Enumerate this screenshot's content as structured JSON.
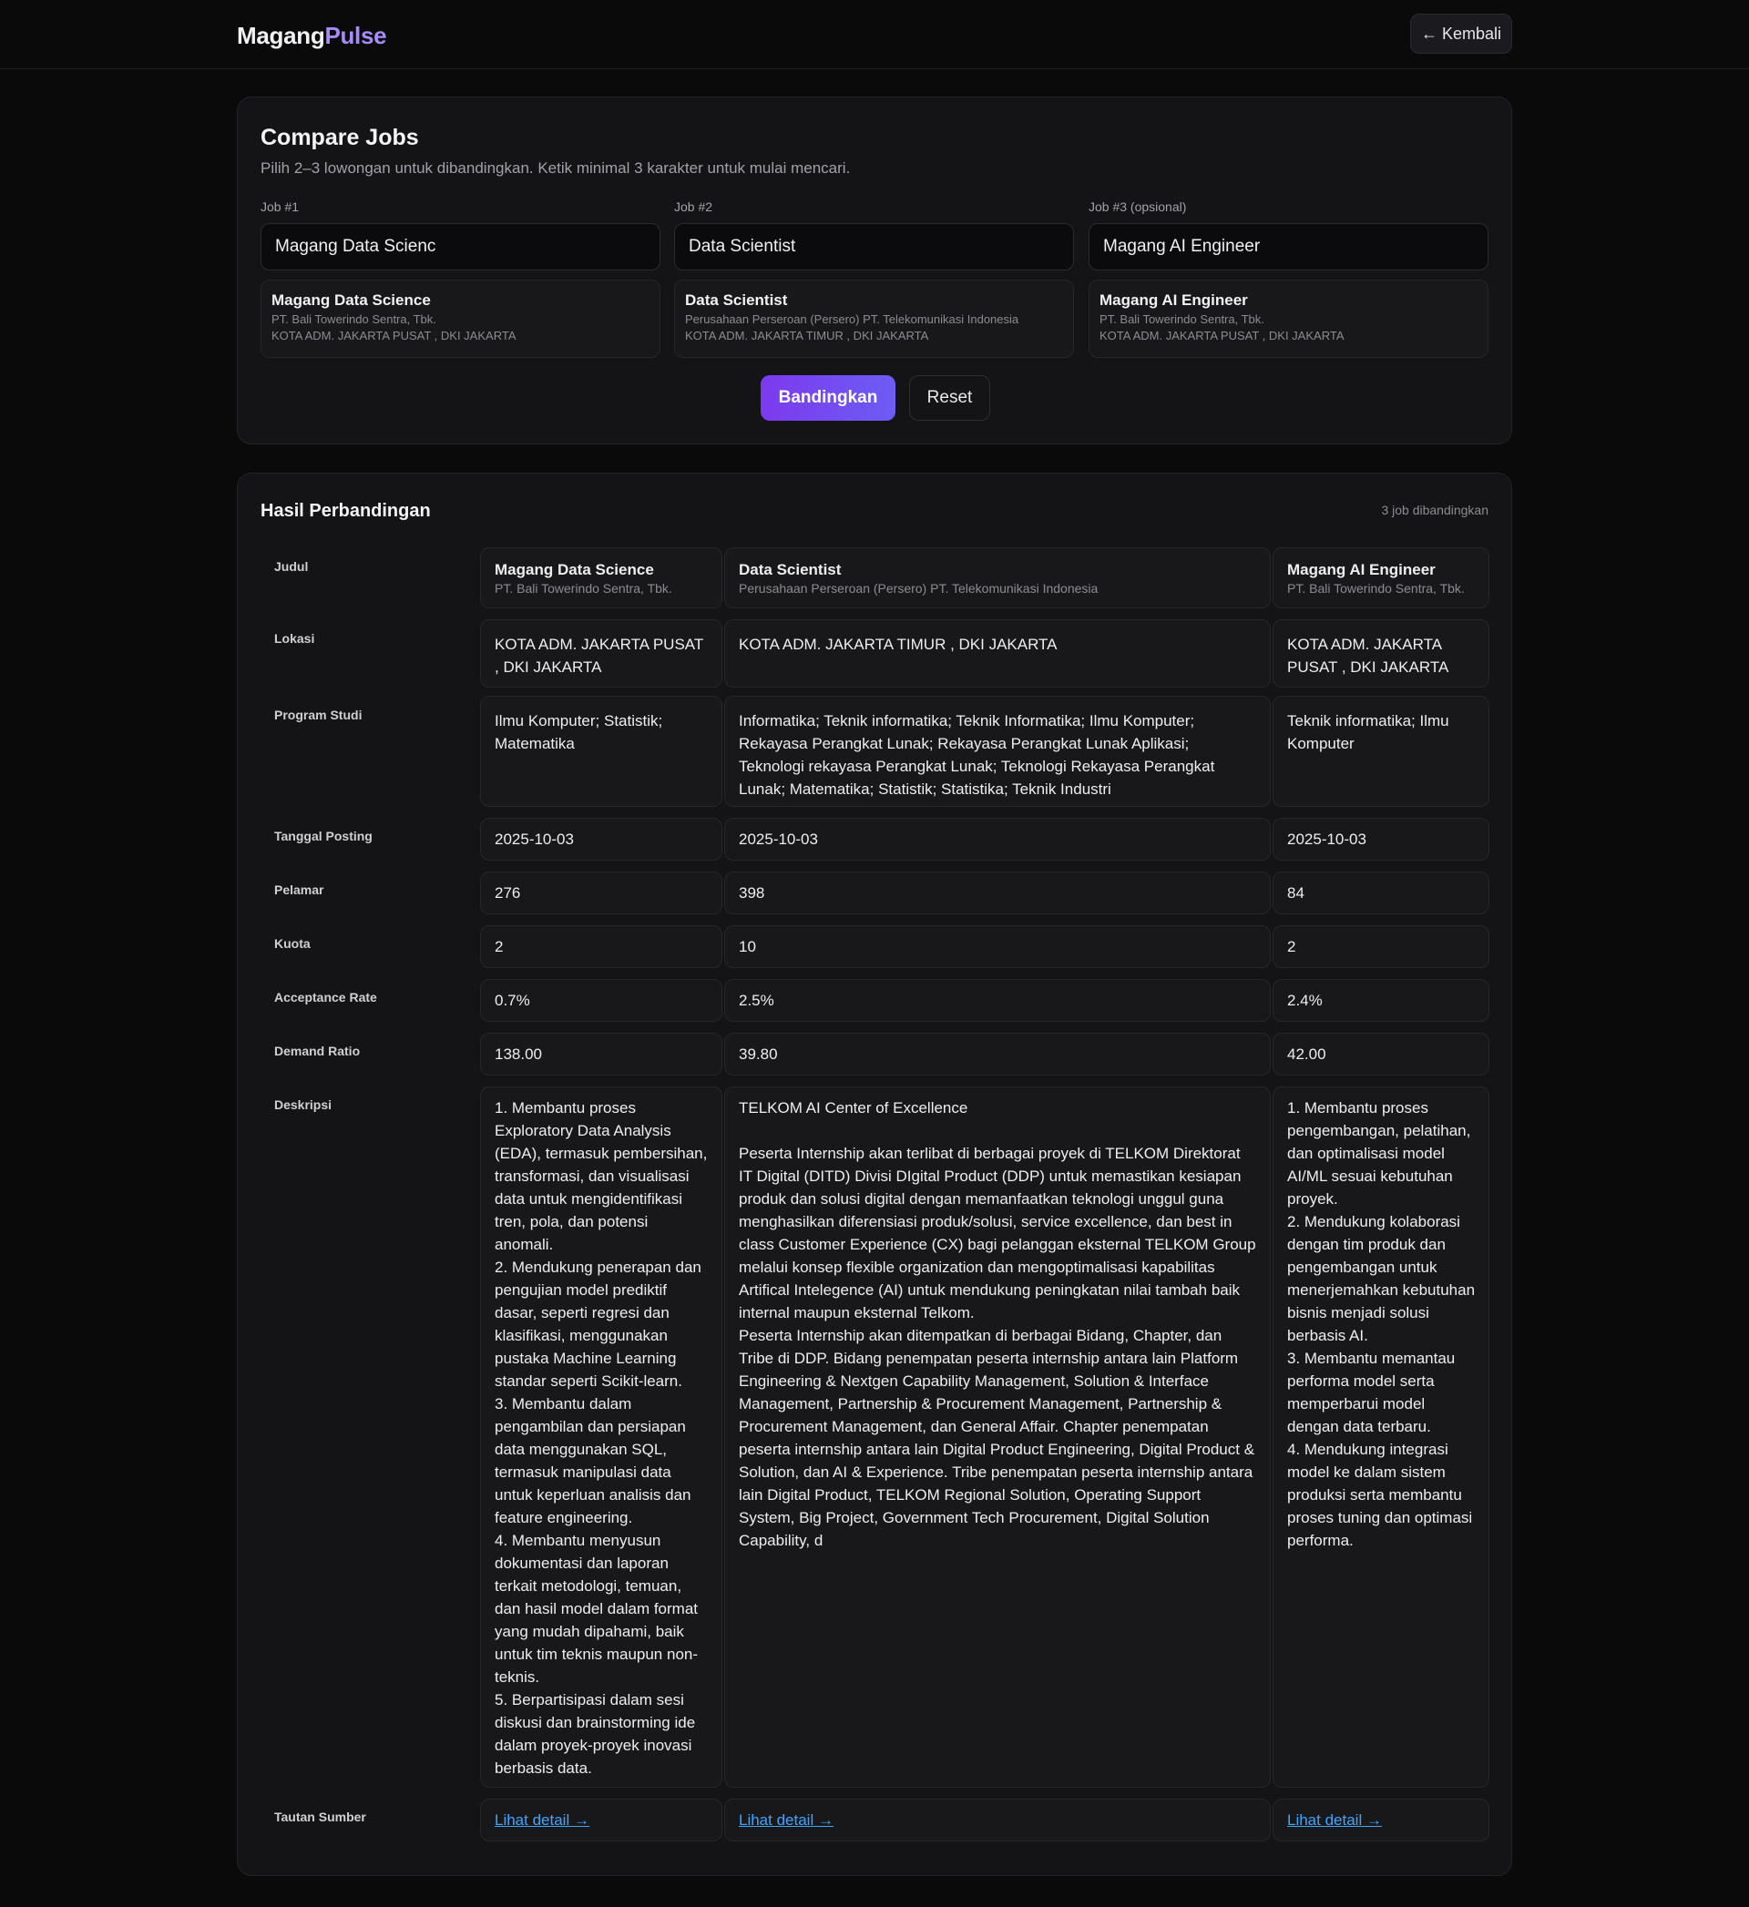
{
  "brand": {
    "part1": "Magang",
    "part2": "Pulse",
    "accent_color": "#a78bfa"
  },
  "header": {
    "back_label": "← Kembali"
  },
  "compare": {
    "title": "Compare Jobs",
    "subtitle": "Pilih 2–3 lowongan untuk dibandingkan. Ketik minimal 3 karakter untuk mulai mencari.",
    "slots": [
      {
        "label": "Job #1",
        "value": "Magang Data Scienc",
        "selected": {
          "title": "Magang Data Science",
          "company": "PT. Bali Towerindo Sentra, Tbk.",
          "location": "KOTA ADM. JAKARTA PUSAT , DKI JAKARTA"
        }
      },
      {
        "label": "Job #2",
        "value": "Data Scientist",
        "selected": {
          "title": "Data Scientist",
          "company": "Perusahaan Perseroan (Persero) PT. Telekomunikasi Indonesia",
          "location": "KOTA ADM. JAKARTA TIMUR , DKI JAKARTA"
        }
      },
      {
        "label": "Job #3 (opsional)",
        "value": "Magang AI Engineer",
        "selected": {
          "title": "Magang AI Engineer",
          "company": "PT. Bali Towerindo Sentra, Tbk.",
          "location": "KOTA ADM. JAKARTA PUSAT , DKI JAKARTA"
        }
      }
    ],
    "compare_button": "Bandingkan",
    "reset_button": "Reset",
    "primary_color": "#7c3aed"
  },
  "results": {
    "title": "Hasil Perbandingan",
    "count_text": "3 job dibandingkan",
    "row_labels": {
      "title": "Judul",
      "location": "Lokasi",
      "program": "Program Studi",
      "posted": "Tanggal Posting",
      "applicants": "Pelamar",
      "quota": "Kuota",
      "acceptance": "Acceptance Rate",
      "demand": "Demand Ratio",
      "description": "Deskripsi",
      "source": "Tautan Sumber"
    },
    "jobs": [
      {
        "title": "Magang Data Science",
        "company": "PT. Bali Towerindo Sentra, Tbk.",
        "location": "KOTA ADM. JAKARTA PUSAT , DKI JAKARTA",
        "program": "Ilmu Komputer; Statistik; Matematika",
        "posted": "2025-10-03",
        "applicants": "276",
        "quota": "2",
        "acceptance": "0.7%",
        "demand": "138.00",
        "description": "1. Membantu proses Exploratory Data Analysis (EDA), termasuk pembersihan, transformasi, dan visualisasi data untuk mengidentifikasi tren, pola, dan potensi anomali.\n2. Mendukung penerapan dan pengujian model prediktif dasar, seperti regresi dan klasifikasi, menggunakan pustaka Machine Learning standar seperti Scikit-learn.\n3. Membantu dalam pengambilan dan persiapan data menggunakan SQL, termasuk manipulasi data untuk keperluan analisis dan feature engineering.\n4. Membantu menyusun dokumentasi dan laporan terkait metodologi, temuan, dan hasil model dalam format yang mudah dipahami, baik untuk tim teknis maupun non-teknis.\n5. Berpartisipasi dalam sesi diskusi dan brainstorming ide dalam proyek-proyek inovasi berbasis data.",
        "link": "Lihat detail →"
      },
      {
        "title": "Data Scientist",
        "company": "Perusahaan Perseroan (Persero) PT. Telekomunikasi Indonesia",
        "location": "KOTA ADM. JAKARTA TIMUR , DKI JAKARTA",
        "program": "Informatika; Teknik informatika; Teknik Informatika; Ilmu Komputer; Rekayasa Perangkat Lunak; Rekayasa Perangkat Lunak Aplikasi; Teknologi rekayasa Perangkat Lunak; Teknologi Rekayasa Perangkat Lunak; Matematika; Statistik; Statistika; Teknik Industri",
        "posted": "2025-10-03",
        "applicants": "398",
        "quota": "10",
        "acceptance": "2.5%",
        "demand": "39.80",
        "description": "TELKOM AI Center of Excellence\n\nPeserta Internship akan terlibat di berbagai proyek di TELKOM Direktorat IT Digital (DITD) Divisi DIgital Product (DDP) untuk memastikan kesiapan produk dan solusi digital dengan memanfaatkan teknologi unggul guna menghasilkan diferensiasi produk/solusi, service excellence, dan best in class Customer Experience (CX) bagi pelanggan eksternal TELKOM Group melalui konsep flexible organization dan mengoptimalisasi kapabilitas Artifical Intelegence (AI) untuk mendukung peningkatan nilai tambah baik internal maupun eksternal Telkom.\nPeserta Internship akan ditempatkan di berbagai Bidang, Chapter, dan Tribe di DDP. Bidang penempatan peserta internship antara lain Platform Engineering & Nextgen Capability Management, Solution & Interface Management, Partnership & Procurement Management, Partnership & Procurement Management, dan General Affair. Chapter penempatan peserta internship antara lain Digital Product Engineering, Digital Product & Solution, dan AI & Experience. Tribe penempatan peserta internship antara lain Digital Product, TELKOM Regional Solution, Operating Support System, Big Project, Government Tech Procurement, Digital Solution Capability, d",
        "link": "Lihat detail →"
      },
      {
        "title": "Magang AI Engineer",
        "company": "PT. Bali Towerindo Sentra, Tbk.",
        "location": "KOTA ADM. JAKARTA PUSAT , DKI JAKARTA",
        "program": "Teknik informatika; Ilmu Komputer",
        "posted": "2025-10-03",
        "applicants": "84",
        "quota": "2",
        "acceptance": "2.4%",
        "demand": "42.00",
        "description": "1. Membantu proses pengembangan, pelatihan, dan optimalisasi model AI/ML sesuai kebutuhan proyek.\n2. Mendukung kolaborasi dengan tim produk dan pengembangan untuk menerjemahkan kebutuhan bisnis menjadi solusi berbasis AI.\n3. Membantu memantau performa model serta memperbarui model dengan data terbaru.\n4. Mendukung integrasi model ke dalam sistem produksi serta membantu proses tuning dan optimasi performa.",
        "link": "Lihat detail →"
      }
    ],
    "link_color": "#3ea6ff"
  }
}
